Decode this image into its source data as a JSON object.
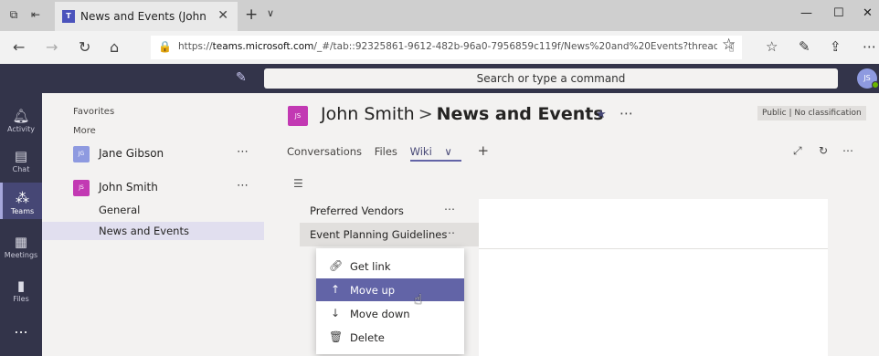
{
  "browser": {
    "tab_title": "News and Events (John",
    "tab_favicon": "T",
    "url_prefix": "https://",
    "url_host": "teams.microsoft.com",
    "url_rest": "/_#/tab::92325861-9612-482b-96a0-7956859c119f/News%20and%20Events?threadId=19:15d"
  },
  "teams": {
    "search_placeholder": "Search or type a command",
    "user_initials": "JS",
    "colors": {
      "rail": "#33344a",
      "accent": "#6264a7",
      "team_js": "#c239b3",
      "team_jg": "#8e9ae0"
    }
  },
  "rail": {
    "items": [
      {
        "label": "Activity",
        "icon": "bell-icon"
      },
      {
        "label": "Chat",
        "icon": "chat-icon"
      },
      {
        "label": "Teams",
        "icon": "teams-icon"
      },
      {
        "label": "Meetings",
        "icon": "calendar-icon"
      },
      {
        "label": "Files",
        "icon": "file-icon"
      }
    ],
    "more": "..."
  },
  "sidebar": {
    "favorites": "Favorites",
    "more": "More",
    "teams": [
      {
        "initials": "JG",
        "name": "Jane Gibson"
      },
      {
        "initials": "JS",
        "name": "John Smith"
      }
    ],
    "channels": [
      "General",
      "News and Events"
    ]
  },
  "channel": {
    "initials": "JS",
    "team": "John Smith",
    "sep": ">",
    "name": "News and Events",
    "badge": "Public | No classification",
    "tabs": [
      "Conversations",
      "Files",
      "Wiki"
    ]
  },
  "wiki": {
    "pages": [
      "Preferred Vendors",
      "Event Planning Guidelines"
    ]
  },
  "context_menu": {
    "items": [
      {
        "label": "Get link",
        "icon": "link-icon"
      },
      {
        "label": "Move up",
        "icon": "arrow-up-icon"
      },
      {
        "label": "Move down",
        "icon": "arrow-down-icon"
      },
      {
        "label": "Delete",
        "icon": "trash-icon"
      }
    ]
  }
}
